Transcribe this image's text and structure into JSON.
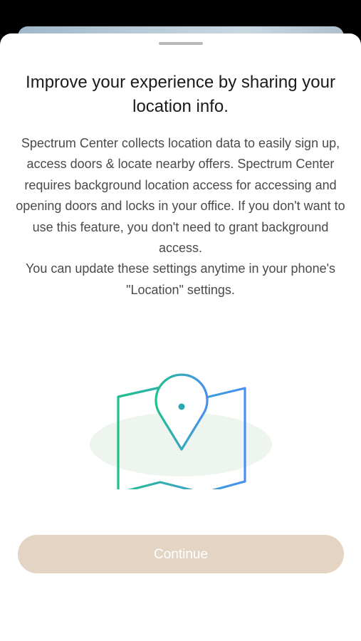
{
  "sheet": {
    "title": "Improve your experience by sharing your location info.",
    "paragraphs": [
      "Spectrum Center collects location data to easily sign up, access doors & locate nearby offers. Spectrum Center requires background location access for accessing and opening doors and locks in your office. If you don't want to use this feature, you don't need to grant background access.",
      "You can update these settings anytime in your phone's \"Location\" settings."
    ],
    "illustration_icon": "map-location-pin-icon",
    "continue_label": "Continue"
  },
  "colors": {
    "button_background": "#e3d4c4",
    "button_text": "#ffffff",
    "illustration_gradient_start": "#22bf8e",
    "illustration_gradient_end": "#4a8ff0",
    "illustration_ellipse": "#edf5ee"
  }
}
